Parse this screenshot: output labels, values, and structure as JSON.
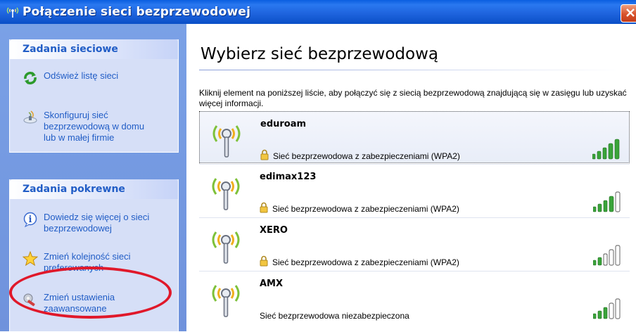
{
  "window": {
    "title": "Połączenie sieci bezprzewodowej",
    "title_icon": "wireless-signal-icon",
    "close_icon": "close-icon"
  },
  "sidebar": {
    "network_tasks": {
      "header": "Zadania sieciowe",
      "items": [
        {
          "label": "Odśwież listę sieci",
          "icon": "refresh-icon"
        },
        {
          "label": "Skonfiguruj sieć\nbezprzewodową w domu\nlub w małej firmie",
          "icon": "setup-wizard-icon"
        }
      ]
    },
    "related_tasks": {
      "header": "Zadania pokrewne",
      "items": [
        {
          "label": "Dowiedz się więcej o sieci\nbezprzewodowej",
          "icon": "info-icon"
        },
        {
          "label": "Zmień kolejność sieci\npreferowanych",
          "icon": "star-icon"
        },
        {
          "label": "Zmień ustawienia\nzaawansowane",
          "icon": "settings-wrench-icon"
        }
      ]
    }
  },
  "main": {
    "heading": "Wybierz sieć bezprzewodową",
    "description": "Kliknij element na poniższej liście, aby połączyć się z siecią bezprzewodową znajdującą się w zasięgu lub uzyskać więcej informacji.",
    "networks": [
      {
        "ssid": "eduroam",
        "status": "Sieć bezprzewodowa z zabezpieczeniami (WPA2)",
        "secured": true,
        "signal_bars": 5,
        "selected": true
      },
      {
        "ssid": "edimax123",
        "status": "Sieć bezprzewodowa z zabezpieczeniami (WPA2)",
        "secured": true,
        "signal_bars": 4,
        "selected": false
      },
      {
        "ssid": "XERO",
        "status": "Sieć bezprzewodowa z zabezpieczeniami (WPA2)",
        "secured": true,
        "signal_bars": 2,
        "selected": false
      },
      {
        "ssid": "AMX",
        "status": "Sieć bezprzewodowa niezabezpieczona",
        "secured": false,
        "signal_bars": 3,
        "selected": false
      }
    ]
  },
  "colors": {
    "title_bar": "#1d62dc",
    "sidebar_bg": "#7aa1e6",
    "link": "#215dc6",
    "signal_on": "#3aa43a",
    "highlight_ellipse": "#e0182a"
  }
}
